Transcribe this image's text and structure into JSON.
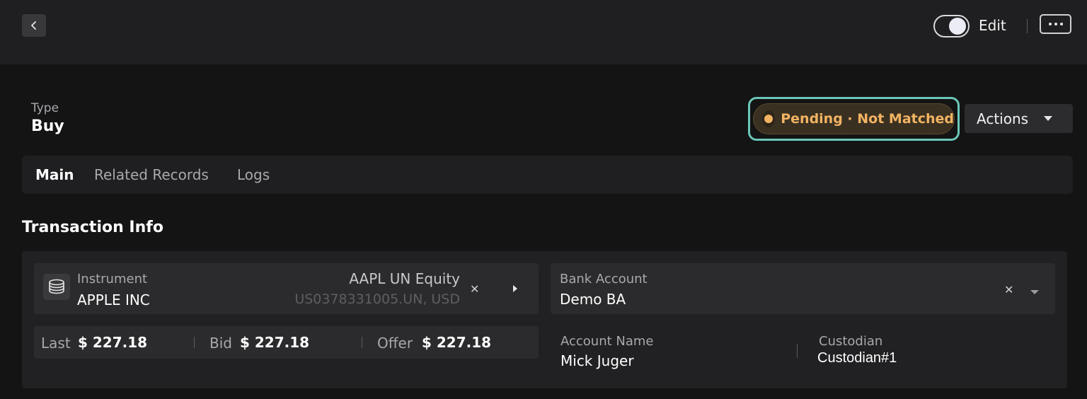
{
  "topbar": {
    "edit_label": "Edit",
    "edit_toggle_on": true
  },
  "header": {
    "type_label": "Type",
    "type_value": "Buy",
    "status": "Pending · Not Matched",
    "status_color": "#f2b463",
    "actions_label": "Actions"
  },
  "tabs": [
    {
      "label": "Main",
      "active": true
    },
    {
      "label": "Related Records",
      "active": false
    },
    {
      "label": "Logs",
      "active": false
    }
  ],
  "section": {
    "title": "Transaction Info"
  },
  "instrument": {
    "label": "Instrument",
    "name": "APPLE INC",
    "ticker": "AAPL UN Equity",
    "isin": "US0378331005.UN, USD"
  },
  "prices": {
    "last_label": "Last",
    "last_value": "$ 227.18",
    "bid_label": "Bid",
    "bid_value": "$ 227.18",
    "offer_label": "Offer",
    "offer_value": "$ 227.18"
  },
  "bank_account": {
    "label": "Bank Account",
    "value": "Demo BA"
  },
  "account": {
    "name_label": "Account Name",
    "name_value": "Mick Juger",
    "custodian_label": "Custodian",
    "custodian_value": "Custodian#1"
  },
  "colors": {
    "accent_outline": "#6bc7b8",
    "background": "#141414"
  }
}
